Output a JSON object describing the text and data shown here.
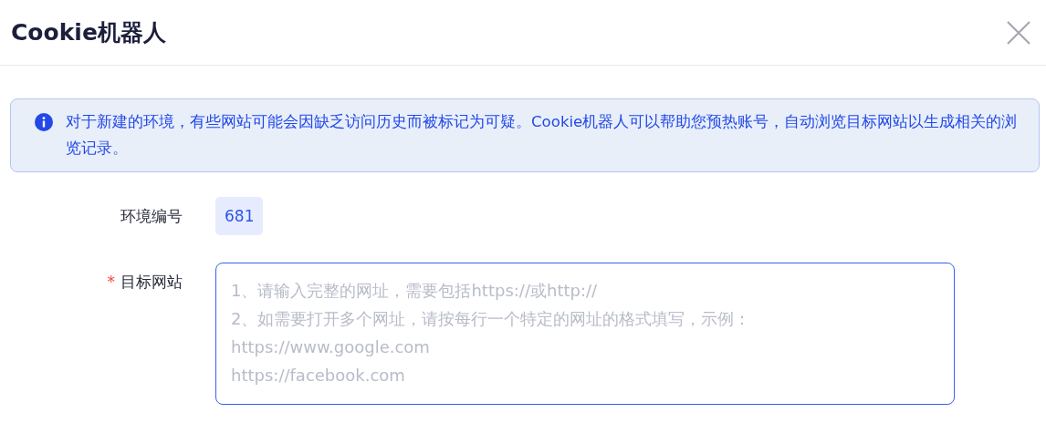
{
  "dialog": {
    "title": "Cookie机器人"
  },
  "alert": {
    "text": "对于新建的环境，有些网站可能会因缺乏访问历史而被标记为可疑。Cookie机器人可以帮助您预热账号，自动浏览目标网站以生成相关的浏览记录。"
  },
  "fields": [
    {
      "kind": "tag",
      "label": "环境编号",
      "value": "681"
    },
    {
      "kind": "textarea",
      "label": "目标网站",
      "required_mark": "*",
      "placeholder": "1、请输入完整的网址，需要包括https://或http://\n2、如需要打开多个网址，请按每行一个特定的网址的格式填写，示例：\nhttps://www.google.com\nhttps://facebook.com",
      "focused": true
    }
  ]
}
